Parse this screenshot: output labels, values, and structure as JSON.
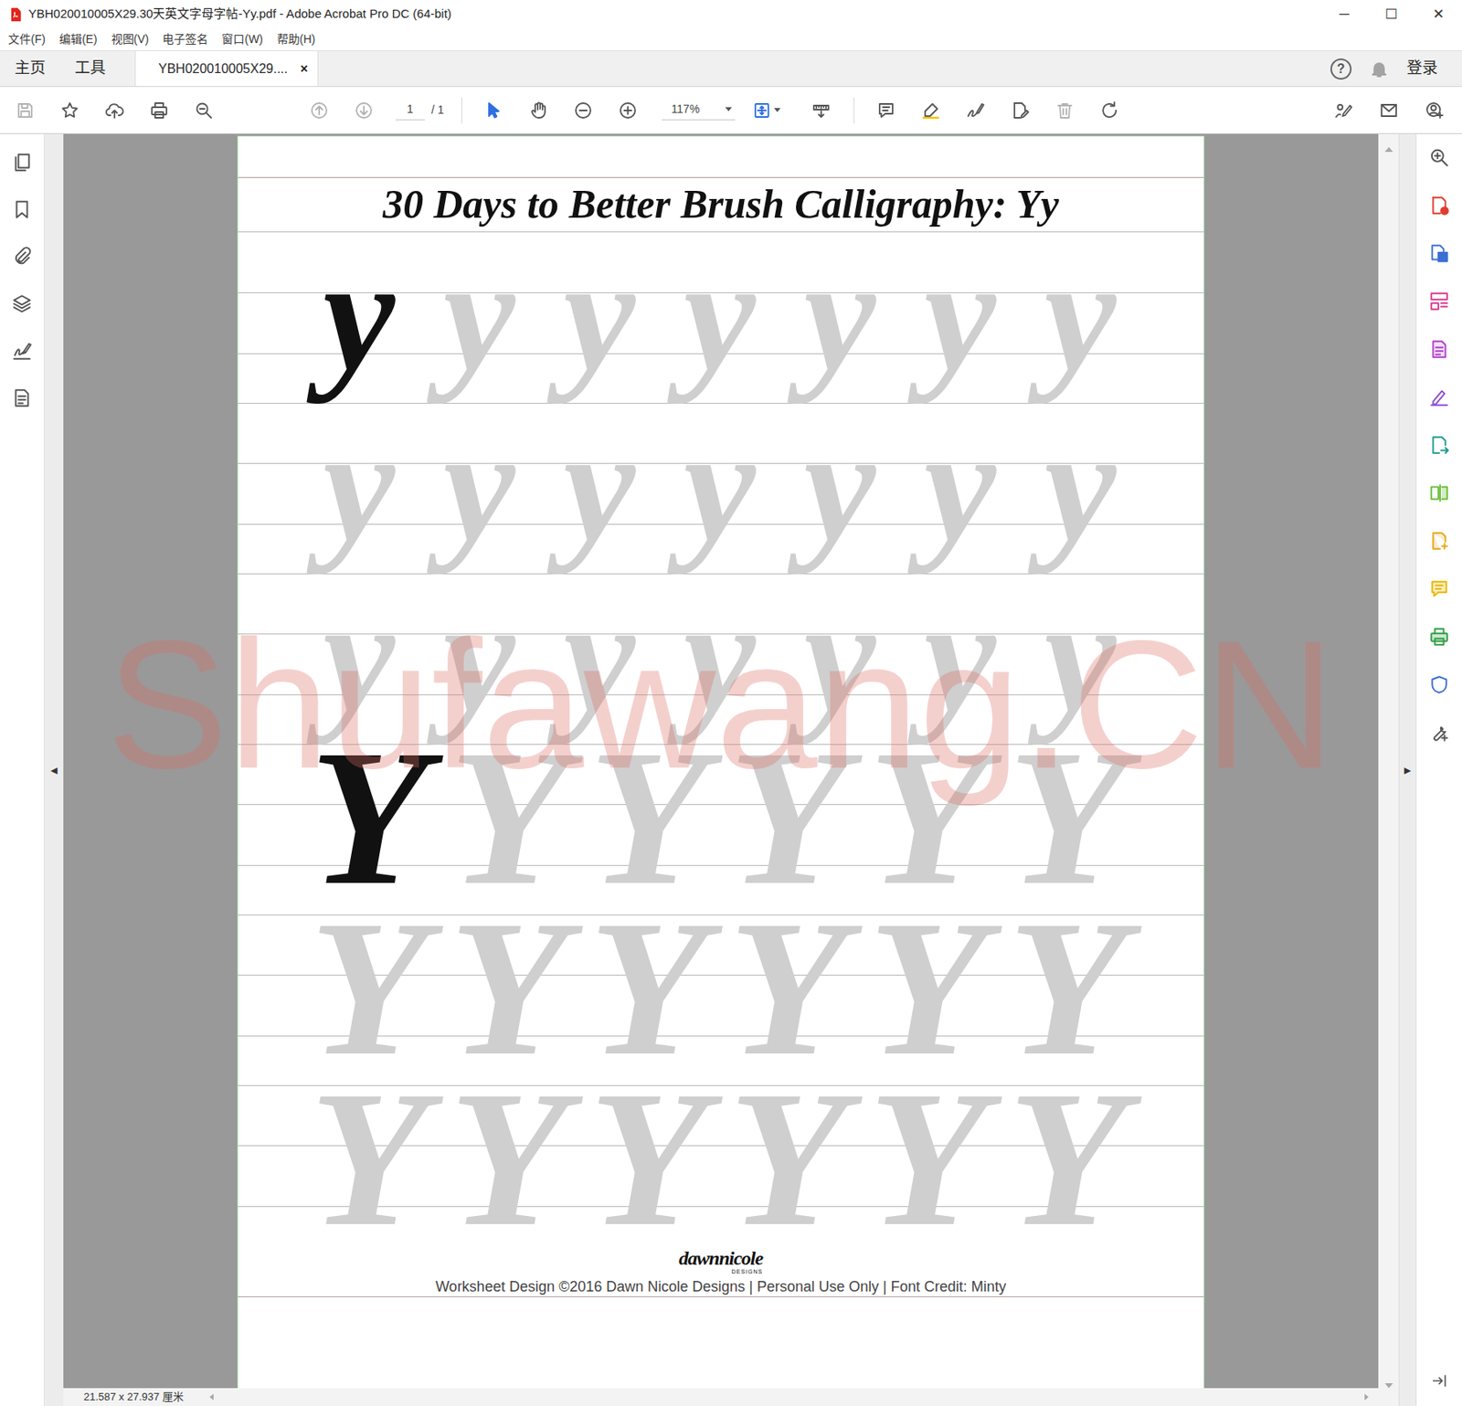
{
  "window": {
    "title": "YBH020010005X29.30天英文字母字帖-Yy.pdf - Adobe Acrobat Pro DC (64-bit)",
    "controls": [
      "─",
      "☐",
      "✕"
    ]
  },
  "menu": [
    "文件(F)",
    "编辑(E)",
    "视图(V)",
    "电子签名",
    "窗口(W)",
    "帮助(H)"
  ],
  "tabs": [
    {
      "label": "主页",
      "kind": "nav",
      "selected": false
    },
    {
      "label": "工具",
      "kind": "nav",
      "selected": false
    },
    {
      "label": "YBH020010005X29....",
      "kind": "document",
      "selected": true,
      "close": "×"
    }
  ],
  "account": {
    "help": "?",
    "login": "登录"
  },
  "toolbar": {
    "page_current": "1",
    "page_total": "/ 1",
    "zoom": "117%",
    "tools": [
      {
        "disabled": true
      },
      {
        "disabled": false
      },
      {
        "disabled": false
      },
      {
        "disabled": false
      },
      {
        "disabled": false
      },
      {
        "disabled": true
      },
      {
        "disabled": true
      },
      {
        "disabled": false
      },
      {
        "disabled": false
      },
      {
        "disabled": false
      },
      {
        "disabled": false
      },
      {
        "disabled": false
      },
      {
        "disabled": false
      },
      {
        "disabled": false
      },
      {
        "disabled": false
      },
      {
        "disabled": false
      },
      {
        "disabled": false
      },
      {
        "disabled": true
      },
      {
        "disabled": false
      },
      {
        "disabled": false
      },
      {
        "disabled": false
      },
      {
        "disabled": false
      }
    ]
  },
  "panels": {
    "left_toggle": "◀",
    "right_toggle": "▶"
  },
  "document": {
    "title": "30 Days to Better Brush Calligraphy: Yy",
    "sections": [
      {
        "kind": "lowercase",
        "rows": [
          {
            "letters": [
              {
                "char": "y",
                "kind": "model"
              },
              {
                "char": "y",
                "kind": "trace"
              },
              {
                "char": "y",
                "kind": "trace"
              },
              {
                "char": "y",
                "kind": "trace"
              },
              {
                "char": "y",
                "kind": "trace"
              },
              {
                "char": "y",
                "kind": "trace"
              },
              {
                "char": "y",
                "kind": "trace"
              }
            ]
          },
          {
            "letters": [
              {
                "char": "y",
                "kind": "trace"
              },
              {
                "char": "y",
                "kind": "trace"
              },
              {
                "char": "y",
                "kind": "trace"
              },
              {
                "char": "y",
                "kind": "trace"
              },
              {
                "char": "y",
                "kind": "trace"
              },
              {
                "char": "y",
                "kind": "trace"
              },
              {
                "char": "y",
                "kind": "trace"
              }
            ]
          },
          {
            "letters": [
              {
                "char": "y",
                "kind": "trace"
              },
              {
                "char": "y",
                "kind": "trace"
              },
              {
                "char": "y",
                "kind": "trace"
              },
              {
                "char": "y",
                "kind": "trace"
              },
              {
                "char": "y",
                "kind": "trace"
              },
              {
                "char": "y",
                "kind": "trace"
              },
              {
                "char": "y",
                "kind": "trace"
              }
            ]
          }
        ]
      },
      {
        "kind": "uppercase",
        "rows": [
          {
            "letters": [
              {
                "char": "Y",
                "kind": "model"
              },
              {
                "char": "Y",
                "kind": "trace"
              },
              {
                "char": "Y",
                "kind": "trace"
              },
              {
                "char": "Y",
                "kind": "trace"
              },
              {
                "char": "Y",
                "kind": "trace"
              },
              {
                "char": "Y",
                "kind": "trace"
              }
            ]
          },
          {
            "letters": [
              {
                "char": "Y",
                "kind": "trace"
              },
              {
                "char": "Y",
                "kind": "trace"
              },
              {
                "char": "Y",
                "kind": "trace"
              },
              {
                "char": "Y",
                "kind": "trace"
              },
              {
                "char": "Y",
                "kind": "trace"
              },
              {
                "char": "Y",
                "kind": "trace"
              }
            ]
          },
          {
            "letters": [
              {
                "char": "Y",
                "kind": "trace"
              },
              {
                "char": "Y",
                "kind": "trace"
              },
              {
                "char": "Y",
                "kind": "trace"
              },
              {
                "char": "Y",
                "kind": "trace"
              },
              {
                "char": "Y",
                "kind": "trace"
              },
              {
                "char": "Y",
                "kind": "trace"
              }
            ]
          }
        ]
      }
    ],
    "logo": "dawnnicole",
    "logo_sub": "DESIGNS",
    "credit": "Worksheet Design ©2016 Dawn Nicole Designs | Personal Use Only | Font Credit: Minty"
  },
  "watermark": "Shufawang.CN",
  "status_bar": {
    "page_size": "21.587 x 27.937 厘米"
  }
}
